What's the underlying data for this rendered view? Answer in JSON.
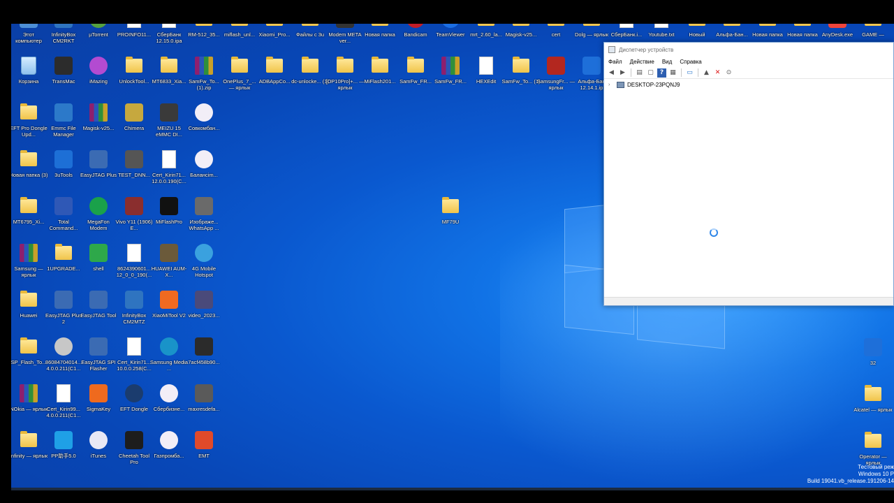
{
  "desktop": {
    "top_row": [
      {
        "label": "Этот компьютер",
        "icon": "pc-icon",
        "kind": "app",
        "color": "#4d8fd6"
      },
      {
        "label": "InfinityBox CM2RKT",
        "icon": "infinitybox-icon",
        "kind": "app",
        "color": "#2f74c0"
      },
      {
        "label": "µTorrent",
        "icon": "utorrent-icon",
        "kind": "round",
        "color": "#56a23f"
      },
      {
        "label": "PROINFO11...",
        "icon": "document-icon",
        "kind": "doc"
      },
      {
        "label": "СберБанк 12.15.0.ipa",
        "icon": "document-icon",
        "kind": "doc"
      },
      {
        "label": "RM-512_35...",
        "icon": "folder-icon",
        "kind": "folder"
      },
      {
        "label": "miflash_unl...",
        "icon": "folder-icon",
        "kind": "folder"
      },
      {
        "label": "Xiaomi_Pro...",
        "icon": "folder-icon",
        "kind": "folder"
      },
      {
        "label": "Файлы с 3u",
        "icon": "folder-icon",
        "kind": "folder"
      },
      {
        "label": "Modem META ver...",
        "icon": "meta-icon",
        "kind": "app",
        "color": "#333"
      },
      {
        "label": "Новая папка",
        "icon": "folder-icon",
        "kind": "folder"
      },
      {
        "label": "Bandicam",
        "icon": "bandicam-icon",
        "kind": "round",
        "color": "#c21d27"
      },
      {
        "label": "TeamViewer",
        "icon": "teamviewer-icon",
        "kind": "round",
        "color": "#1b6ee3"
      },
      {
        "label": "mrt_2.60_la...",
        "icon": "folder-icon",
        "kind": "folder"
      },
      {
        "label": "Magisk-v25...",
        "icon": "folder-icon",
        "kind": "folder"
      },
      {
        "label": "cert",
        "icon": "folder-icon",
        "kind": "folder"
      },
      {
        "label": "Dolg — ярлык",
        "icon": "folder-icon",
        "kind": "folder"
      },
      {
        "label": "СберБанк.i...",
        "icon": "document-icon",
        "kind": "doc"
      },
      {
        "label": "Youtube.txt",
        "icon": "document-icon",
        "kind": "doc"
      },
      {
        "label": "Новый",
        "icon": "folder-icon",
        "kind": "folder"
      },
      {
        "label": "Альфа-Бан...",
        "icon": "folder-icon",
        "kind": "folder"
      },
      {
        "label": "Новая папка",
        "icon": "folder-icon",
        "kind": "folder"
      },
      {
        "label": "Новая папка",
        "icon": "folder-icon",
        "kind": "folder"
      },
      {
        "label": "AnyDesk.exe",
        "icon": "anydesk-icon",
        "kind": "app",
        "color": "#ef443b"
      },
      {
        "label": "GAME —",
        "icon": "folder-icon",
        "kind": "folder"
      }
    ],
    "second_row": [
      {
        "label": "Корзина",
        "icon": "recycle-bin-icon",
        "kind": "recycle"
      },
      {
        "label": "TransMac",
        "icon": "transmac-icon",
        "kind": "app",
        "color": "#2c2c2c"
      },
      {
        "label": "iMazing",
        "icon": "imazing-icon",
        "kind": "round",
        "color": "#b34bd1"
      },
      {
        "label": "UnlockTool...",
        "icon": "folder-icon",
        "kind": "folder"
      },
      {
        "label": "MT6833_Xia...",
        "icon": "folder-icon",
        "kind": "folder"
      },
      {
        "label": "SamFw_To... (1).zip",
        "icon": "winrar-icon",
        "kind": "rar"
      },
      {
        "label": "OnePlus_7_... — ярлык",
        "icon": "folder-icon",
        "kind": "folder"
      },
      {
        "label": "ADBAppCo...",
        "icon": "folder-icon",
        "kind": "folder"
      },
      {
        "label": "dc-unlocke... (1)",
        "icon": "folder-icon",
        "kind": "folder"
      },
      {
        "label": "[OP10Pro]+... — ярлык",
        "icon": "folder-icon",
        "kind": "folder"
      },
      {
        "label": "MiFlash201...",
        "icon": "folder-icon",
        "kind": "folder"
      },
      {
        "label": "SamFw_FR...",
        "icon": "folder-icon",
        "kind": "folder"
      },
      {
        "label": "SamFw_FR...",
        "icon": "winrar-icon",
        "kind": "rar"
      },
      {
        "label": "HEXEdit",
        "icon": "document-icon",
        "kind": "doc"
      },
      {
        "label": "SamFw_To... (1)",
        "icon": "folder-icon",
        "kind": "folder"
      },
      {
        "label": "SamsungFr... — ярлык",
        "icon": "samsung-tool-icon",
        "kind": "app",
        "color": "#b3271f"
      },
      {
        "label": "Альфа-Бан 12.14.1.ip",
        "icon": "ipa-icon",
        "kind": "app",
        "color": "#1e6fd9"
      }
    ],
    "columns": [
      [
        {
          "label": "EFT Pro Dongle Upd...",
          "icon": "folder-icon",
          "kind": "folder"
        },
        {
          "label": "Новая папка (3)",
          "icon": "folder-icon",
          "kind": "folder"
        },
        {
          "label": "MT6795_Xi...",
          "icon": "folder-icon",
          "kind": "folder"
        },
        {
          "label": "Samsung — ярлык",
          "icon": "winrar-icon",
          "kind": "rar"
        },
        {
          "label": "Huawei",
          "icon": "folder-icon",
          "kind": "folder"
        },
        {
          "label": "SP_Flash_To...",
          "icon": "folder-icon",
          "kind": "folder"
        },
        {
          "label": "NOkia — ярлык",
          "icon": "winrar-icon",
          "kind": "rar"
        },
        {
          "label": "Infinity — ярлык",
          "icon": "folder-icon",
          "kind": "folder"
        }
      ],
      [
        {
          "label": "Emmc File Manager",
          "icon": "emmc-icon",
          "kind": "app",
          "color": "#2c79c9"
        },
        {
          "label": "3uTools",
          "icon": "3utools-icon",
          "kind": "app",
          "color": "#1d6fd6"
        },
        {
          "label": "Total Command...",
          "icon": "total-commander-icon",
          "kind": "app",
          "color": "#2f58b6"
        },
        {
          "label": "1UPGRADE...",
          "icon": "folder-icon",
          "kind": "folder"
        },
        {
          "label": "EasyJTAG Plus 2",
          "icon": "easyjtag-icon",
          "kind": "app",
          "color": "#3b6bb3"
        },
        {
          "label": "86084704014... 4.0.0.211(C1...",
          "icon": "disc-icon",
          "kind": "round",
          "color": "#c7c7c7"
        },
        {
          "label": "Cert_Kirin99... 4.0.0.211(C1...",
          "icon": "document-icon",
          "kind": "doc"
        },
        {
          "label": "PP助手5.0",
          "icon": "pp-icon",
          "kind": "app",
          "color": "#1fa0e6"
        }
      ],
      [
        {
          "label": "Magisk-v25...",
          "icon": "winrar-icon",
          "kind": "rar"
        },
        {
          "label": "EasyJTAG Plus",
          "icon": "easyjtag-icon",
          "kind": "app",
          "color": "#3b6bb3"
        },
        {
          "label": "MegaFon Modem",
          "icon": "megafon-icon",
          "kind": "round",
          "color": "#1aa14a"
        },
        {
          "label": "shell",
          "icon": "shell-icon",
          "kind": "app",
          "color": "#2ea84a"
        },
        {
          "label": "EasyJTAG Tool",
          "icon": "easyjtag-icon",
          "kind": "app",
          "color": "#3b6bb3"
        },
        {
          "label": "EasyJTAG SPI Flasher",
          "icon": "easyjtag-icon",
          "kind": "app",
          "color": "#3b6bb3"
        },
        {
          "label": "SigmaKey",
          "icon": "sigmakey-icon",
          "kind": "app",
          "color": "#ef6a1e"
        },
        {
          "label": "iTunes",
          "icon": "itunes-icon",
          "kind": "round",
          "color": "#e8e8f5"
        }
      ],
      [
        {
          "label": "Chimera",
          "icon": "chimera-icon",
          "kind": "app",
          "color": "#c6a83e"
        },
        {
          "label": "TEST_DNN...",
          "icon": "video-icon",
          "kind": "app",
          "color": "#555"
        },
        {
          "label": "Vivo Y11 (1906) E...",
          "icon": "image-icon",
          "kind": "app",
          "color": "#8a2e2e"
        },
        {
          "label": "8624390601... 12_0_0_190(...",
          "icon": "document-icon",
          "kind": "doc"
        },
        {
          "label": "InfinityBox CM2MTZ",
          "icon": "mtk-icon",
          "kind": "app",
          "color": "#2f74c0"
        },
        {
          "label": "Cert_Kirin71... 10.0.0.258(C...",
          "icon": "document-icon",
          "kind": "doc"
        },
        {
          "label": "EFT Dongle",
          "icon": "eft-icon",
          "kind": "round",
          "color": "#1b3c6e"
        },
        {
          "label": "Cheetah Tool Pro",
          "icon": "cheetah-icon",
          "kind": "app",
          "color": "#1d1d1d"
        }
      ],
      [
        {
          "label": "MEIZU 15 eMMC DI...",
          "icon": "image-icon",
          "kind": "app",
          "color": "#3a3a3a"
        },
        {
          "label": "Cert_Kirin71... 12.0.0.190(C...",
          "icon": "document-icon",
          "kind": "doc"
        },
        {
          "label": "MiFlashPro",
          "icon": "miflash-icon",
          "kind": "app",
          "color": "#111"
        },
        {
          "label": "HUAWEI AUM-X...",
          "icon": "image-icon",
          "kind": "app",
          "color": "#6b5a3a"
        },
        {
          "label": "XiaoMiTool V2",
          "icon": "xiaomitool-icon",
          "kind": "app",
          "color": "#f06a21"
        },
        {
          "label": "Samsung Media ...",
          "icon": "media-icon",
          "kind": "round",
          "color": "#1993c9"
        },
        {
          "label": "Сбербизне...",
          "icon": "sber-icon",
          "kind": "round",
          "color": "#f2eef7"
        },
        {
          "label": "Газпромба...",
          "icon": "gazprom-icon",
          "kind": "round",
          "color": "#f2eef7"
        }
      ],
      [
        {
          "label": "Совкомбан...",
          "icon": "sovcom-icon",
          "kind": "round",
          "color": "#f2eef7"
        },
        {
          "label": "Балансim...",
          "icon": "balance-icon",
          "kind": "round",
          "color": "#f2eef7"
        },
        {
          "label": "Изображе... WhatsApp ...",
          "icon": "image-icon",
          "kind": "app",
          "color": "#6a6a6a"
        },
        {
          "label": "4G Mobile Hotspot",
          "icon": "hotspot-icon",
          "kind": "round",
          "color": "#3aa1df"
        },
        {
          "label": "video_2023...",
          "icon": "video-icon",
          "kind": "app",
          "color": "#4a4a7a"
        },
        {
          "label": "7acf458b90...",
          "icon": "image-icon",
          "kind": "app",
          "color": "#2b2b2b"
        },
        {
          "label": "maxresdefa...",
          "icon": "image-icon",
          "kind": "app",
          "color": "#5a5a5a"
        },
        {
          "label": "EMT",
          "icon": "emt-icon",
          "kind": "app",
          "color": "#e04a2a"
        }
      ]
    ],
    "loose": [
      {
        "label": "MF79U",
        "icon": "folder-icon",
        "kind": "folder"
      },
      {
        "label": "32",
        "icon": "ipa-icon",
        "kind": "app",
        "color": "#1e6fd9"
      },
      {
        "label": "Alcatel — ярлык",
        "icon": "folder-icon",
        "kind": "folder"
      },
      {
        "label": "Operator — ярлык",
        "icon": "folder-icon",
        "kind": "folder"
      }
    ]
  },
  "device_manager": {
    "title": "Диспетчер устройств",
    "menu": [
      "Файл",
      "Действие",
      "Вид",
      "Справка"
    ],
    "tree_root": "DESKTOP-23PQNJ9"
  },
  "watermark": {
    "line1": "Тестовый реж",
    "line2": "Windows 10 P",
    "line3": "Build 19041.vb_release.191206-14"
  }
}
